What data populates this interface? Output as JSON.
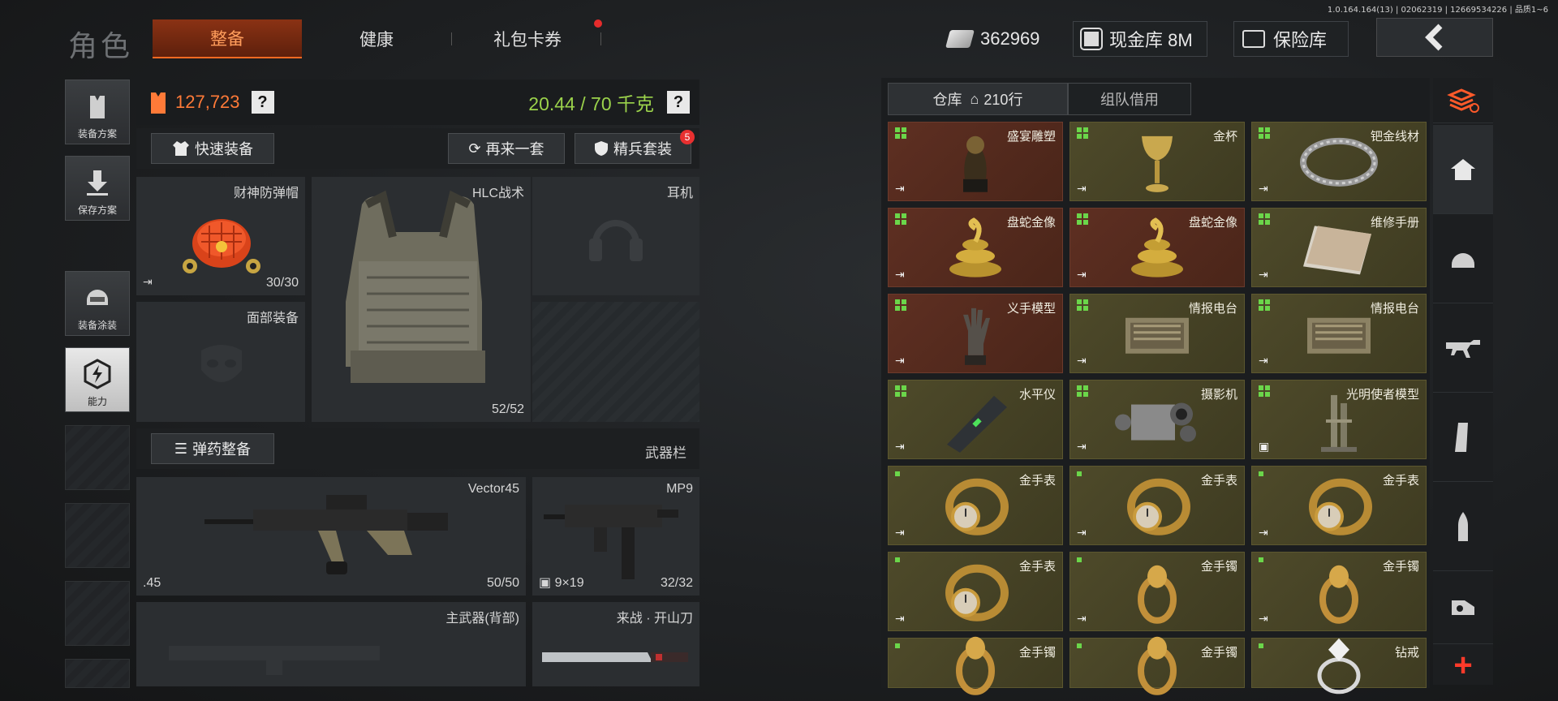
{
  "version": "1.0.164.164(13) | 02062319 | 12669534226 | 品质1~6",
  "header": {
    "title": "角色",
    "tabs": [
      "整备",
      "健康",
      "礼包卡券"
    ],
    "currency": "362969",
    "vault": "现金库 8M",
    "safe": "保险库"
  },
  "sidebar": {
    "items": [
      {
        "label": "装备方案",
        "icon": "vest-icon"
      },
      {
        "label": "保存方案",
        "icon": "download-icon"
      },
      {
        "label": "装备涂装",
        "icon": "helmet-paint-icon"
      },
      {
        "label": "能力",
        "icon": "lightning-icon"
      }
    ]
  },
  "equipment": {
    "money": "127,723",
    "weight": "20.44 / 70 千克",
    "help": "?",
    "quick_equip": "快速装备",
    "again": "再来一套",
    "elite_kit": "精兵套装",
    "elite_badge": "5",
    "ammo_equip": "弹药整备",
    "weapon_bar": "武器栏",
    "slots": {
      "helmet": {
        "name": "财神防弹帽",
        "count": "30/30"
      },
      "armor": {
        "name": "HLC战术",
        "count": "52/52"
      },
      "headset": {
        "name": "耳机"
      },
      "face": {
        "name": "面部装备"
      },
      "gun1": {
        "name": "Vector45",
        "caliber": ".45",
        "count": "50/50"
      },
      "gun2": {
        "name": "MP9",
        "caliber": "9×19",
        "count": "32/32"
      },
      "primary": {
        "name": "主武器(背部)"
      },
      "melee": {
        "name": "来战 · 开山刀"
      }
    }
  },
  "warehouse": {
    "tab_storage": "仓库",
    "rows": "210行",
    "tab_team": "组队借用",
    "items": [
      {
        "name": "盛宴雕塑",
        "style": "red",
        "art": "statue"
      },
      {
        "name": "金杯",
        "style": "gold",
        "art": "cup"
      },
      {
        "name": "钯金线材",
        "style": "gold",
        "art": "wire"
      },
      {
        "name": "盘蛇金像",
        "style": "red",
        "art": "snake"
      },
      {
        "name": "盘蛇金像",
        "style": "red",
        "art": "snake"
      },
      {
        "name": "维修手册",
        "style": "gold",
        "art": "book"
      },
      {
        "name": "义手模型",
        "style": "red",
        "art": "hand"
      },
      {
        "name": "情报电台",
        "style": "gold",
        "art": "radio"
      },
      {
        "name": "情报电台",
        "style": "gold",
        "art": "radio"
      },
      {
        "name": "水平仪",
        "style": "gold",
        "art": "level"
      },
      {
        "name": "摄影机",
        "style": "gold",
        "art": "camera"
      },
      {
        "name": "光明使者模型",
        "style": "gold",
        "art": "tower"
      },
      {
        "name": "金手表",
        "style": "gold",
        "art": "watch"
      },
      {
        "name": "金手表",
        "style": "gold",
        "art": "watch"
      },
      {
        "name": "金手表",
        "style": "gold",
        "art": "watch"
      },
      {
        "name": "金手表",
        "style": "gold",
        "art": "watch"
      },
      {
        "name": "金手镯",
        "style": "gold",
        "art": "bracelet"
      },
      {
        "name": "金手镯",
        "style": "gold",
        "art": "bracelet"
      },
      {
        "name": "金手镯",
        "style": "gold",
        "art": "bracelet"
      },
      {
        "name": "金手镯",
        "style": "gold",
        "art": "bracelet"
      },
      {
        "name": "钻戒",
        "style": "gold",
        "art": "ring"
      }
    ]
  },
  "right_nav": [
    "storage-sort-icon",
    "home-icon",
    "helmet-icon",
    "rifle-icon",
    "magazine-icon",
    "bullet-icon",
    "sight-icon",
    "plus-icon"
  ]
}
